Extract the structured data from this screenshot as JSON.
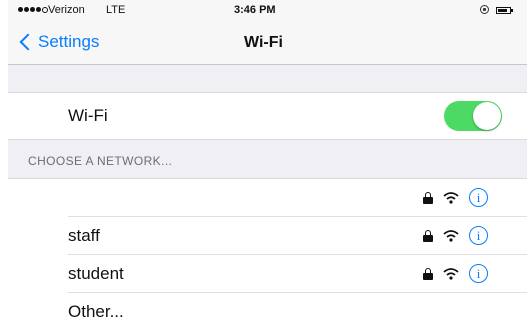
{
  "status_bar": {
    "carrier": "Verizon",
    "network_type": "LTE",
    "time": "3:46 PM",
    "signal_bars_filled": 4,
    "signal_bars_total": 5
  },
  "nav": {
    "back_label": "Settings",
    "title": "Wi-Fi"
  },
  "wifi": {
    "label": "Wi-Fi",
    "enabled": true
  },
  "section_header": "CHOOSE A NETWORK...",
  "networks": [
    {
      "name": "",
      "locked": true
    },
    {
      "name": "staff",
      "locked": true
    },
    {
      "name": "student",
      "locked": true
    },
    {
      "name": "Other...",
      "locked": false
    }
  ],
  "info_glyph": "i",
  "colors": {
    "accent": "#0a7cff",
    "toggle_on": "#4cd964",
    "background": "#efeff4"
  }
}
